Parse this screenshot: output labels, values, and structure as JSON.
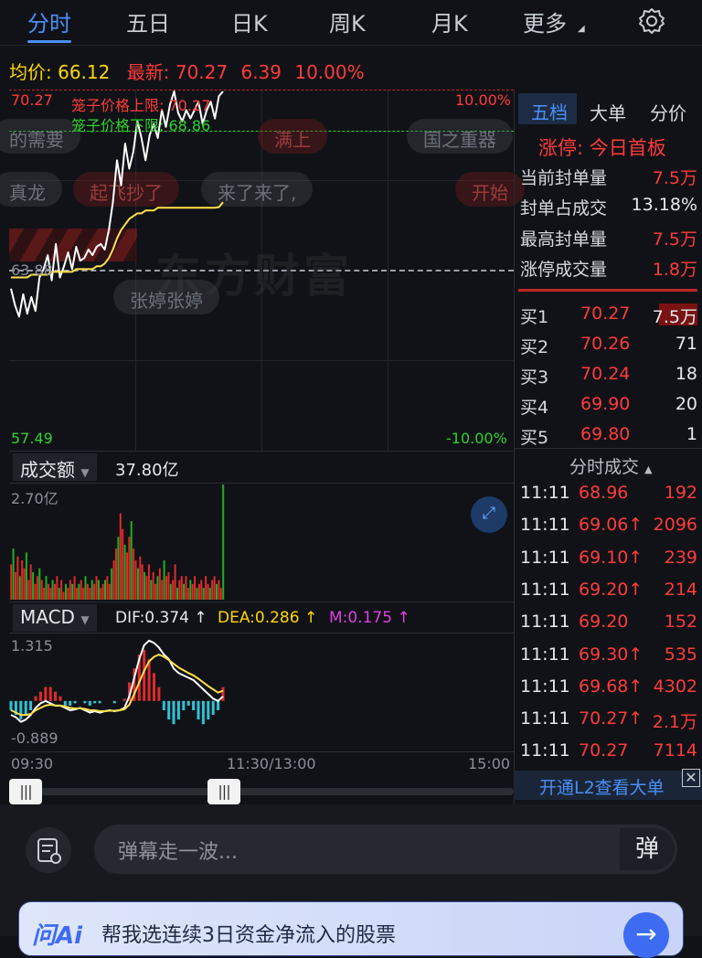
{
  "tabs": {
    "t0": "分时",
    "t1": "五日",
    "t2": "日K",
    "t3": "周K",
    "t4": "月K",
    "t5": "更多"
  },
  "info": {
    "avg_label": "均价:",
    "avg": "66.12",
    "last_label": "最新:",
    "last": "70.27",
    "chg": "6.39",
    "pct": "10.00%"
  },
  "chart": {
    "upper_limit_price": "70.27",
    "upper_pct": "10.00%",
    "lower_price": "57.49",
    "lower_pct": "-10.00%",
    "prev_close": "63.88",
    "cage_up": "笼子价格上限: 70.27",
    "cage_down": "笼子价格下限: 68.86",
    "watermark": "东方财富",
    "danmu": [
      "的需要",
      "满上",
      "国之重器",
      "真龙",
      "起飞抄了",
      "来了来了,",
      "开始",
      "张婷张婷"
    ],
    "price": [
      63.2,
      62.6,
      62.2,
      63.0,
      62.3,
      62.9,
      62.4,
      63.6,
      63.9,
      64.4,
      63.5,
      64.8,
      63.6,
      64.0,
      64.5,
      63.9,
      64.7,
      64.2,
      64.3,
      64.6,
      64.4,
      64.7,
      64.8,
      64.6,
      65.3,
      66.3,
      67.8,
      66.9,
      68.4,
      67.5,
      68.1,
      69.2,
      68.6,
      67.8,
      68.7,
      69.1,
      68.6,
      69.6,
      69.0,
      69.8,
      70.27,
      69.5,
      69.2,
      69.6,
      69.3,
      69.6,
      69.9,
      69.1,
      69.6,
      69.9,
      69.3,
      70.1,
      70.27
    ],
    "avg_line": [
      63.6,
      63.6,
      63.6,
      63.6,
      63.6,
      63.7,
      63.7,
      63.7,
      63.7,
      63.7,
      63.8,
      63.8,
      63.8,
      63.8,
      63.8,
      63.8,
      63.9,
      63.9,
      63.9,
      63.9,
      63.9,
      64.0,
      64.0,
      64.1,
      64.3,
      64.6,
      65.0,
      65.3,
      65.5,
      65.7,
      65.8,
      65.9,
      65.9,
      66.0,
      66.0,
      66.0,
      66.1,
      66.1,
      66.1,
      66.1,
      66.1,
      66.1,
      66.1,
      66.1,
      66.1,
      66.1,
      66.1,
      66.1,
      66.1,
      66.1,
      66.1,
      66.12,
      66.3
    ]
  },
  "volume": {
    "label": "成交额",
    "total": "37.80亿",
    "max_label": "2.70亿",
    "bars": [
      0.9,
      1.3,
      0.7,
      1.1,
      0.6,
      1.0,
      0.8,
      1.2,
      0.5,
      0.9,
      0.7,
      0.4,
      0.6,
      0.8,
      0.5,
      0.3,
      0.6,
      0.4,
      0.3,
      0.5,
      0.4,
      0.6,
      0.3,
      0.5,
      0.2,
      0.4,
      0.3,
      0.5,
      0.4,
      0.6,
      0.3,
      0.4,
      0.5,
      0.3,
      0.6,
      0.4,
      0.3,
      0.5,
      0.4,
      0.6,
      0.5,
      0.3,
      0.4,
      0.5,
      0.6,
      0.4,
      0.8,
      1.0,
      1.3,
      1.6,
      2.2,
      1.8,
      1.4,
      1.2,
      1.6,
      2.0,
      1.3,
      1.0,
      0.8,
      1.1,
      0.9,
      0.7,
      0.6,
      0.9,
      0.5,
      0.7,
      0.4,
      0.6,
      0.8,
      0.5,
      1.0,
      0.6,
      0.7,
      0.4,
      0.5,
      0.9,
      0.3,
      0.5,
      0.6,
      0.4,
      0.6,
      0.3,
      0.5,
      0.4,
      0.6,
      0.3,
      0.4,
      0.5,
      0.3,
      0.6,
      0.4,
      0.3,
      0.5,
      0.6,
      0.4,
      0.5,
      0.3,
      4.6
    ]
  },
  "macd": {
    "label": "MACD",
    "dif": "DIF:0.374 ↑",
    "dea": "DEA:0.286 ↑",
    "m": "M:0.175 ↑",
    "top": "1.315",
    "bottom": "-0.889",
    "dif_line": [
      -0.3,
      -0.35,
      -0.45,
      -0.4,
      -0.3,
      -0.15,
      -0.05,
      0.0,
      -0.05,
      -0.1,
      -0.1,
      -0.15,
      -0.2,
      -0.18,
      -0.15,
      -0.2,
      -0.25,
      -0.22,
      -0.25,
      -0.22,
      -0.2,
      -0.22,
      -0.2,
      -0.15,
      0.1,
      0.5,
      0.9,
      1.2,
      1.3,
      1.25,
      1.15,
      1.0,
      0.9,
      0.7,
      0.6,
      0.55,
      0.5,
      0.45,
      0.35,
      0.25,
      0.15,
      0.05,
      0.0,
      0.1
    ],
    "dea_line": [
      -0.2,
      -0.25,
      -0.3,
      -0.3,
      -0.28,
      -0.2,
      -0.15,
      -0.1,
      -0.08,
      -0.1,
      -0.1,
      -0.12,
      -0.15,
      -0.16,
      -0.16,
      -0.17,
      -0.2,
      -0.2,
      -0.22,
      -0.22,
      -0.21,
      -0.21,
      -0.2,
      -0.18,
      -0.08,
      0.15,
      0.4,
      0.65,
      0.85,
      0.95,
      1.0,
      0.95,
      0.88,
      0.8,
      0.72,
      0.66,
      0.6,
      0.55,
      0.48,
      0.4,
      0.32,
      0.25,
      0.18,
      0.22
    ],
    "hist": [
      -0.2,
      -0.3,
      -0.4,
      -0.3,
      -0.2,
      0.1,
      0.2,
      0.3,
      0.3,
      0.2,
      0.1,
      -0.1,
      -0.1,
      -0.05,
      0.0,
      -0.05,
      -0.1,
      -0.05,
      -0.05,
      0.0,
      0.0,
      -0.05,
      0.0,
      0.05,
      0.4,
      0.7,
      1.0,
      1.1,
      0.9,
      0.6,
      0.3,
      -0.2,
      -0.4,
      -0.5,
      -0.4,
      -0.2,
      -0.1,
      -0.2,
      -0.4,
      -0.5,
      -0.4,
      -0.3,
      -0.2,
      0.3
    ]
  },
  "time": {
    "start": "09:30",
    "mid": "11:30/13:00",
    "end": "15:00"
  },
  "panel": {
    "tabs": {
      "a": "五档",
      "b": "大单",
      "c": "分价"
    },
    "limit_title": "涨停: 今日首板",
    "stats": [
      {
        "k": "当前封单量",
        "v": "7.5万"
      },
      {
        "k": "封单占成交",
        "v": "13.18%"
      },
      {
        "k": "最高封单量",
        "v": "7.5万"
      },
      {
        "k": "涨停成交量",
        "v": "1.8万"
      }
    ],
    "bids": [
      {
        "k": "买1",
        "p": "70.27",
        "v": "7.5万"
      },
      {
        "k": "买2",
        "p": "70.26",
        "v": "71"
      },
      {
        "k": "买3",
        "p": "70.24",
        "v": "18"
      },
      {
        "k": "买4",
        "p": "69.90",
        "v": "20"
      },
      {
        "k": "买5",
        "p": "69.80",
        "v": "1"
      }
    ],
    "ticks_title": "分时成交",
    "ticks": [
      {
        "t": "11:11",
        "p": "68.96",
        "v": "192"
      },
      {
        "t": "11:11",
        "p": "69.06↑",
        "v": "2096"
      },
      {
        "t": "11:11",
        "p": "69.10↑",
        "v": "239"
      },
      {
        "t": "11:11",
        "p": "69.20↑",
        "v": "214"
      },
      {
        "t": "11:11",
        "p": "69.20",
        "v": "152"
      },
      {
        "t": "11:11",
        "p": "69.30↑",
        "v": "535"
      },
      {
        "t": "11:11",
        "p": "69.68↑",
        "v": "4302"
      },
      {
        "t": "11:11",
        "p": "70.27↑",
        "v": "2.1万"
      },
      {
        "t": "11:11",
        "p": "70.27",
        "v": "7114"
      }
    ],
    "l2": "开通L2查看大单"
  },
  "bottom": {
    "placeholder": "弹幕走一波...",
    "dan": "弹",
    "ai_logo": "问Ai",
    "ai_text": "帮我选连续3日资金净流入的股票"
  }
}
